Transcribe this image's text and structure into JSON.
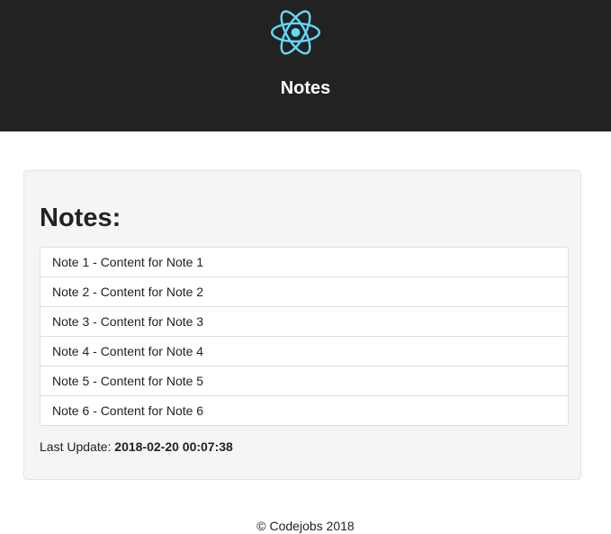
{
  "header": {
    "logo_icon": "react-atom-icon",
    "logo_color": "#61dafb",
    "title": "Notes"
  },
  "main": {
    "heading": "Notes:",
    "notes": [
      {
        "text": "Note 1 - Content for Note 1"
      },
      {
        "text": "Note 2 - Content for Note 2"
      },
      {
        "text": "Note 3 - Content for Note 3"
      },
      {
        "text": "Note 4 - Content for Note 4"
      },
      {
        "text": "Note 5 - Content for Note 5"
      },
      {
        "text": "Note 6 - Content for Note 6"
      }
    ],
    "last_update_label": "Last Update:",
    "last_update_value": "2018-02-20 00:07:38"
  },
  "footer": {
    "text": "© Codejobs 2018"
  },
  "colors": {
    "header_bg": "#222222",
    "panel_bg": "#f5f5f5"
  }
}
